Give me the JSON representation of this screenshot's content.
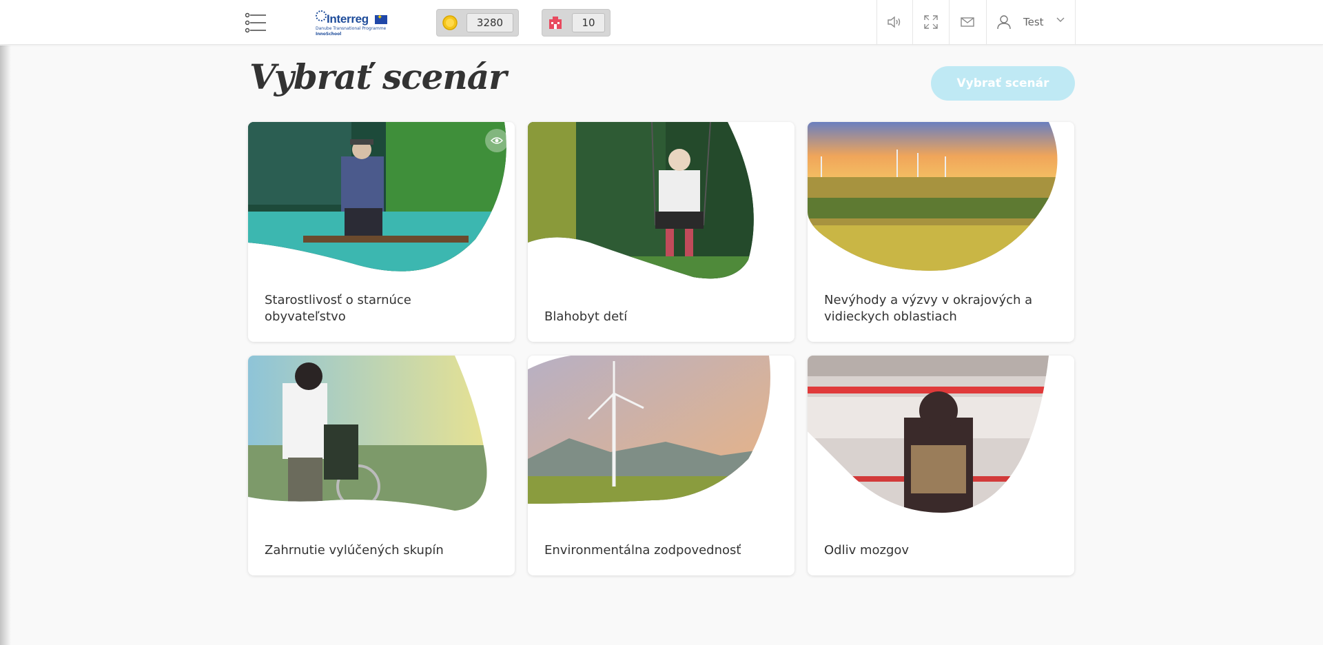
{
  "header": {
    "logo": {
      "brand": "Interreg",
      "program": "Danube Transnational Programme",
      "project": "InnoSchool"
    },
    "stats": [
      {
        "name": "coins",
        "icon": "coin-icon",
        "value": "3280"
      },
      {
        "name": "buildings",
        "icon": "building-icon",
        "value": "10"
      }
    ],
    "icons": [
      "speaker-icon",
      "fullscreen-icon",
      "mail-icon"
    ],
    "user": {
      "label": "Test",
      "icon": "user-icon"
    }
  },
  "main": {
    "title": "Vybrať scenár",
    "select_button": "Vybrať scenár",
    "cards": [
      {
        "label": "Starostlivosť o starnúce obyvateľstvo",
        "image": "elderly-man-on-bench"
      },
      {
        "label": "Blahobyt detí",
        "image": "child-on-swing"
      },
      {
        "label": "Nevýhody a výzvy v okrajových a vidieckych oblastiach",
        "image": "rural-fields-wind-turbines"
      },
      {
        "label": "Zahrnutie vylúčených skupín",
        "image": "woman-with-wheelchair"
      },
      {
        "label": "Environmentálna zodpovednosť",
        "image": "wind-turbine-landscape"
      },
      {
        "label": "Odliv mozgov",
        "image": "person-at-train-station"
      }
    ]
  },
  "colors": {
    "accent_button": "#bfe9f4",
    "background": "#f9f9f9",
    "card": "#ffffff"
  }
}
